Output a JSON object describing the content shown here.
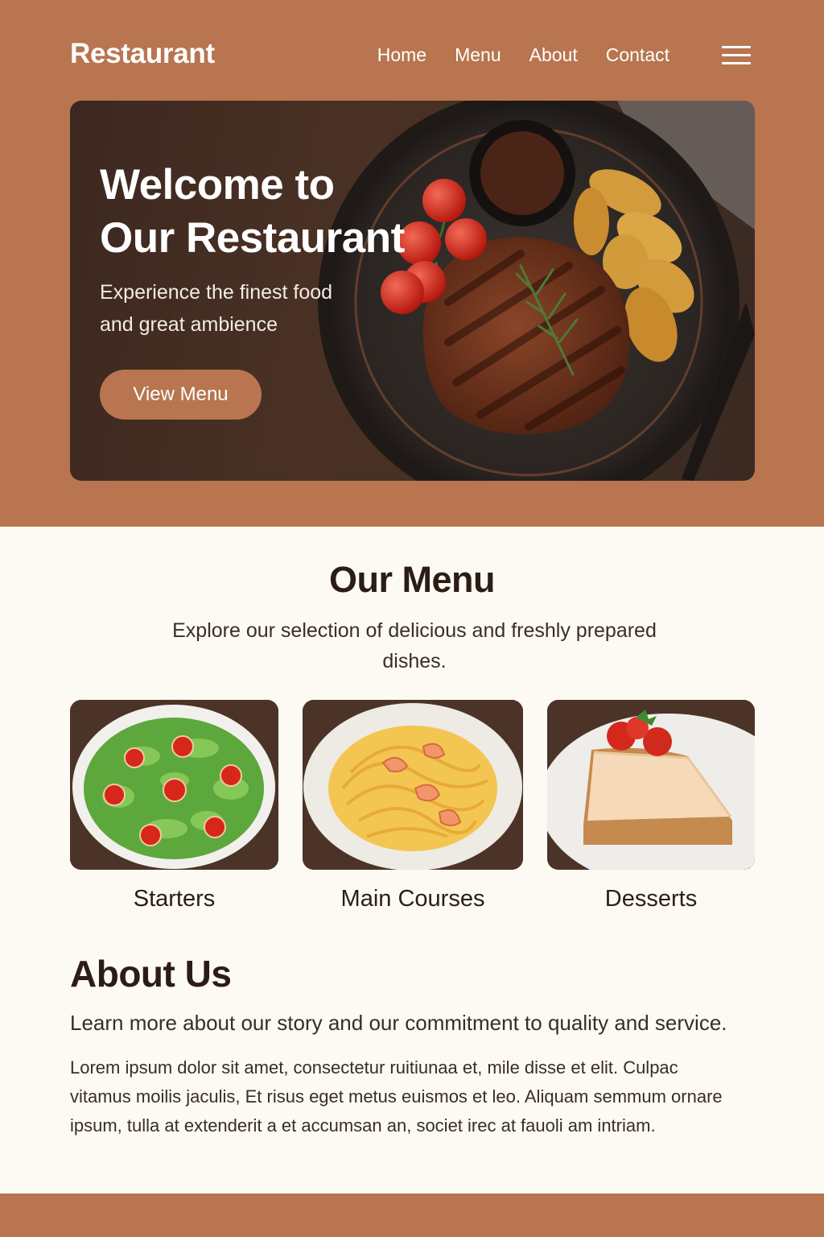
{
  "header": {
    "brand": "Restaurant",
    "nav": [
      "Home",
      "Menu",
      "About",
      "Contact"
    ],
    "menu_icon": "hamburger-icon"
  },
  "hero": {
    "title_line1": "Welcome to",
    "title_line2": "Our Restaurant",
    "subtitle_line1": "Experience the finest food",
    "subtitle_line2": "and great ambience",
    "button": "View Menu",
    "image": "grilled-steak-plate"
  },
  "menu": {
    "title": "Our Menu",
    "description": "Explore our selection of delicious and freshly prepared dishes.",
    "categories": [
      {
        "label": "Starters",
        "image": "salad-bowl"
      },
      {
        "label": "Main Courses",
        "image": "shrimp-pasta"
      },
      {
        "label": "Desserts",
        "image": "cheesecake-slice"
      }
    ]
  },
  "about": {
    "title": "About Us",
    "lead": "Learn more about our story and our commitment to quality and service.",
    "body": "Lorem ipsum dolor sit amet, consectetur ruitiunaa et, mile disse et elit. Culpac vitamus moilis jaculis, Et risus eget metus euismos et leo. Aliquam semmum ornare ipsum, tulla at extenderit a et accumsan an, societ irec at fauoli am intriam."
  },
  "colors": {
    "brand": "#b8754f",
    "page_bg": "#fdfaf4",
    "text_dark": "#2b1d15"
  }
}
